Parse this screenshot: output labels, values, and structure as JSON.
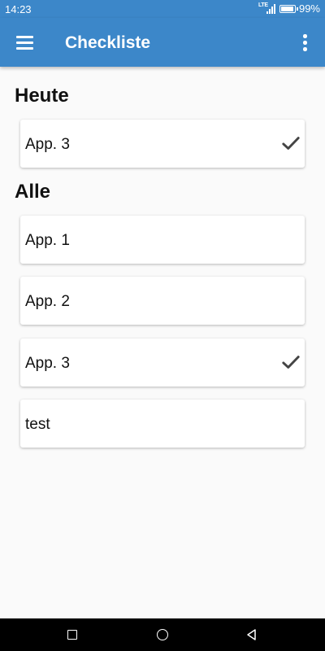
{
  "status_bar": {
    "time": "14:23",
    "network_label": "LTE",
    "battery_text": "99%",
    "battery_level": 0.99,
    "icons": [
      "lte-signal-icon",
      "battery-icon"
    ]
  },
  "app_bar": {
    "title": "Checkliste",
    "left_icon": "menu-icon",
    "right_icon": "more-vert-icon",
    "color": "#3c87c9"
  },
  "sections": {
    "today": {
      "heading": "Heute",
      "items": [
        {
          "label": "App. 3",
          "checked": true
        }
      ]
    },
    "all": {
      "heading": "Alle",
      "items": [
        {
          "label": "App. 1",
          "checked": false
        },
        {
          "label": "App. 2",
          "checked": false
        },
        {
          "label": "App. 3",
          "checked": true
        },
        {
          "label": "test",
          "checked": false
        }
      ]
    }
  },
  "nav_bar": {
    "icons": [
      "recents-square-icon",
      "home-circle-icon",
      "back-triangle-icon"
    ]
  }
}
